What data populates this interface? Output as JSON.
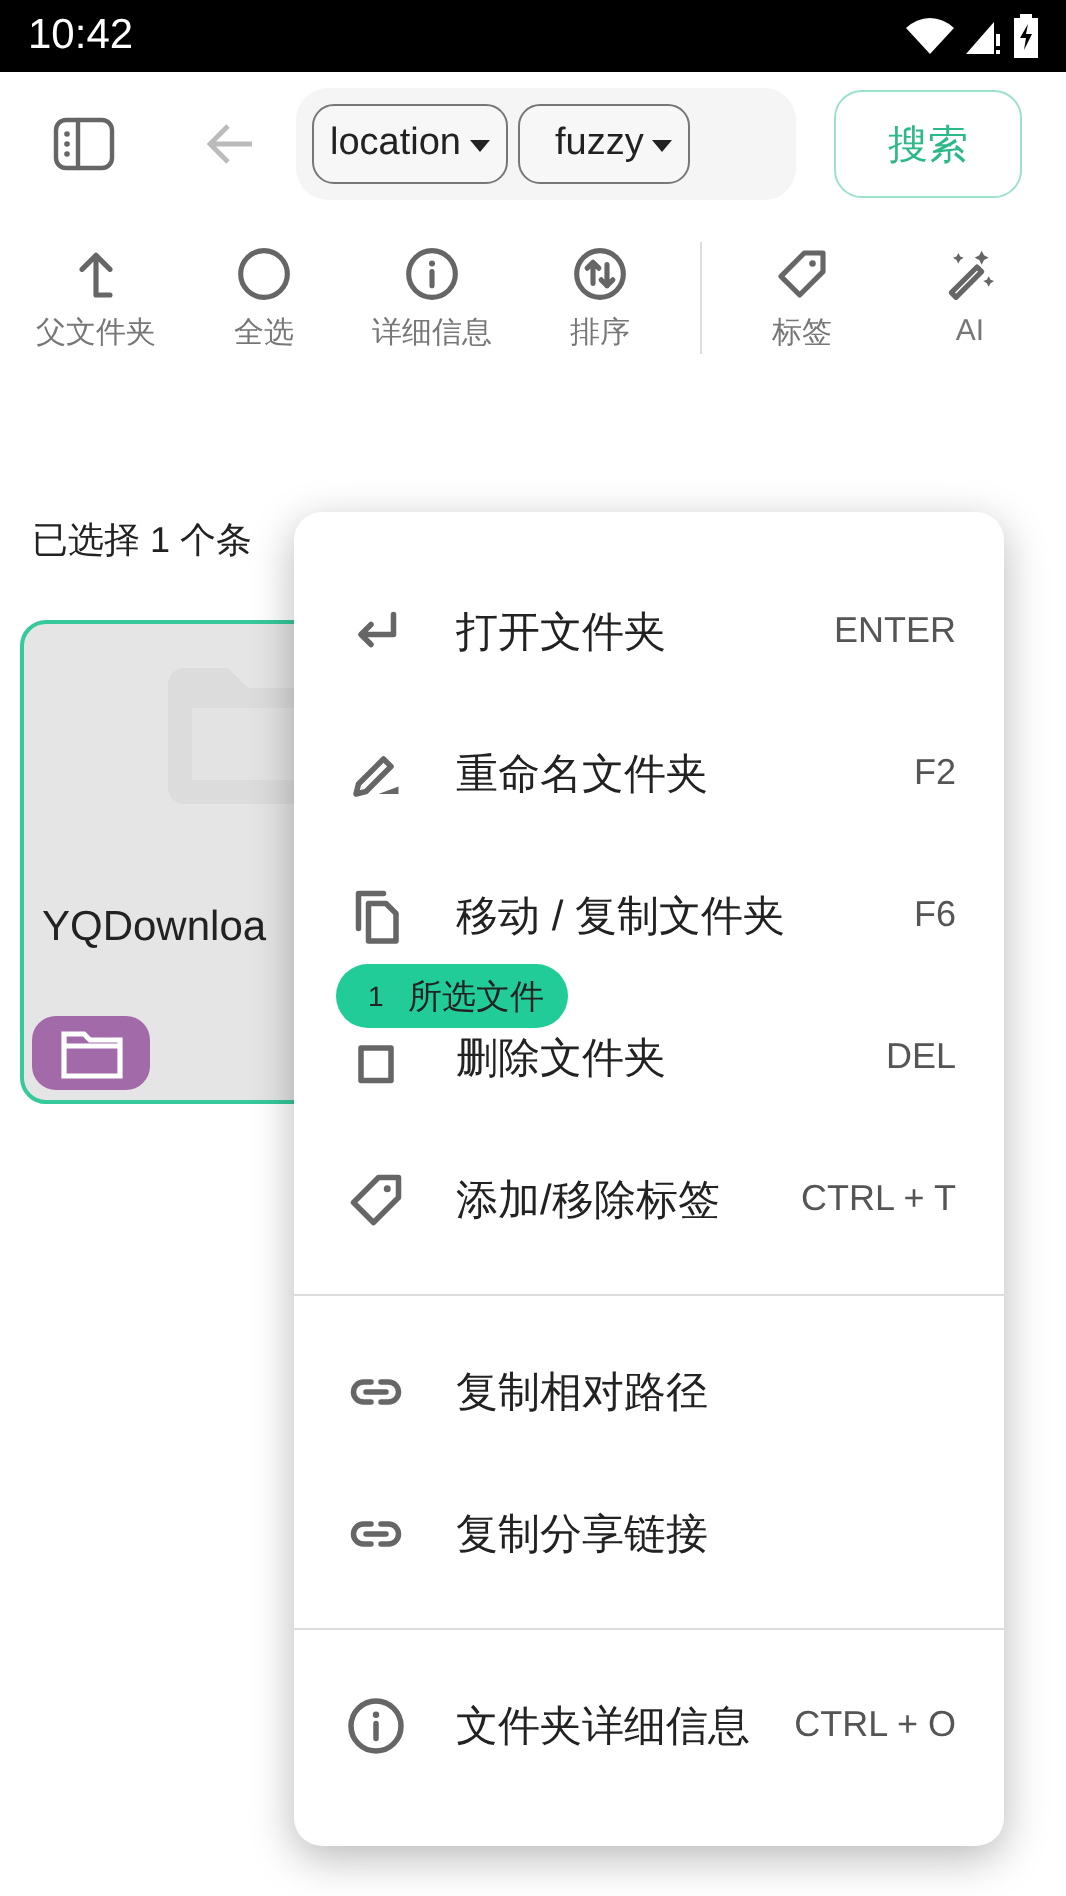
{
  "status_bar": {
    "time": "10:42"
  },
  "top_bar": {
    "back": {
      "disabled": true
    },
    "filters": [
      {
        "label": "location"
      },
      {
        "label": "fuzzy"
      }
    ],
    "search_button": "搜索"
  },
  "actions": [
    {
      "kind": "parent",
      "label": "父文件夹"
    },
    {
      "kind": "select_all",
      "label": "全选"
    },
    {
      "kind": "info",
      "label": "详细信息"
    },
    {
      "kind": "sort",
      "label": "排序"
    }
  ],
  "actions_secondary": [
    {
      "kind": "tag",
      "label": "标签"
    },
    {
      "kind": "ai",
      "label": "AI"
    }
  ],
  "selection_text": "已选择 1 个条",
  "files": [
    {
      "name": "YQDownloa",
      "selected": true,
      "color": "#a36aaa"
    }
  ],
  "drag_chip": {
    "count": "1",
    "label": "所选文件"
  },
  "menu": {
    "sections": [
      [
        {
          "kind": "enter",
          "label": "打开文件夹",
          "shortcut": "ENTER"
        },
        {
          "kind": "rename",
          "label": "重命名文件夹",
          "shortcut": "F2"
        },
        {
          "kind": "copy",
          "label": "移动 / 复制文件夹",
          "shortcut": "F6"
        },
        {
          "kind": "delete",
          "label": "删除文件夹",
          "shortcut": "DEL"
        },
        {
          "kind": "tag",
          "label": "添加/移除标签",
          "shortcut": "CTRL + T"
        }
      ],
      [
        {
          "kind": "link",
          "label": "复制相对路径"
        },
        {
          "kind": "link",
          "label": "复制分享链接"
        }
      ],
      [
        {
          "kind": "info",
          "label": "文件夹详细信息",
          "shortcut": "CTRL + O"
        }
      ]
    ]
  }
}
